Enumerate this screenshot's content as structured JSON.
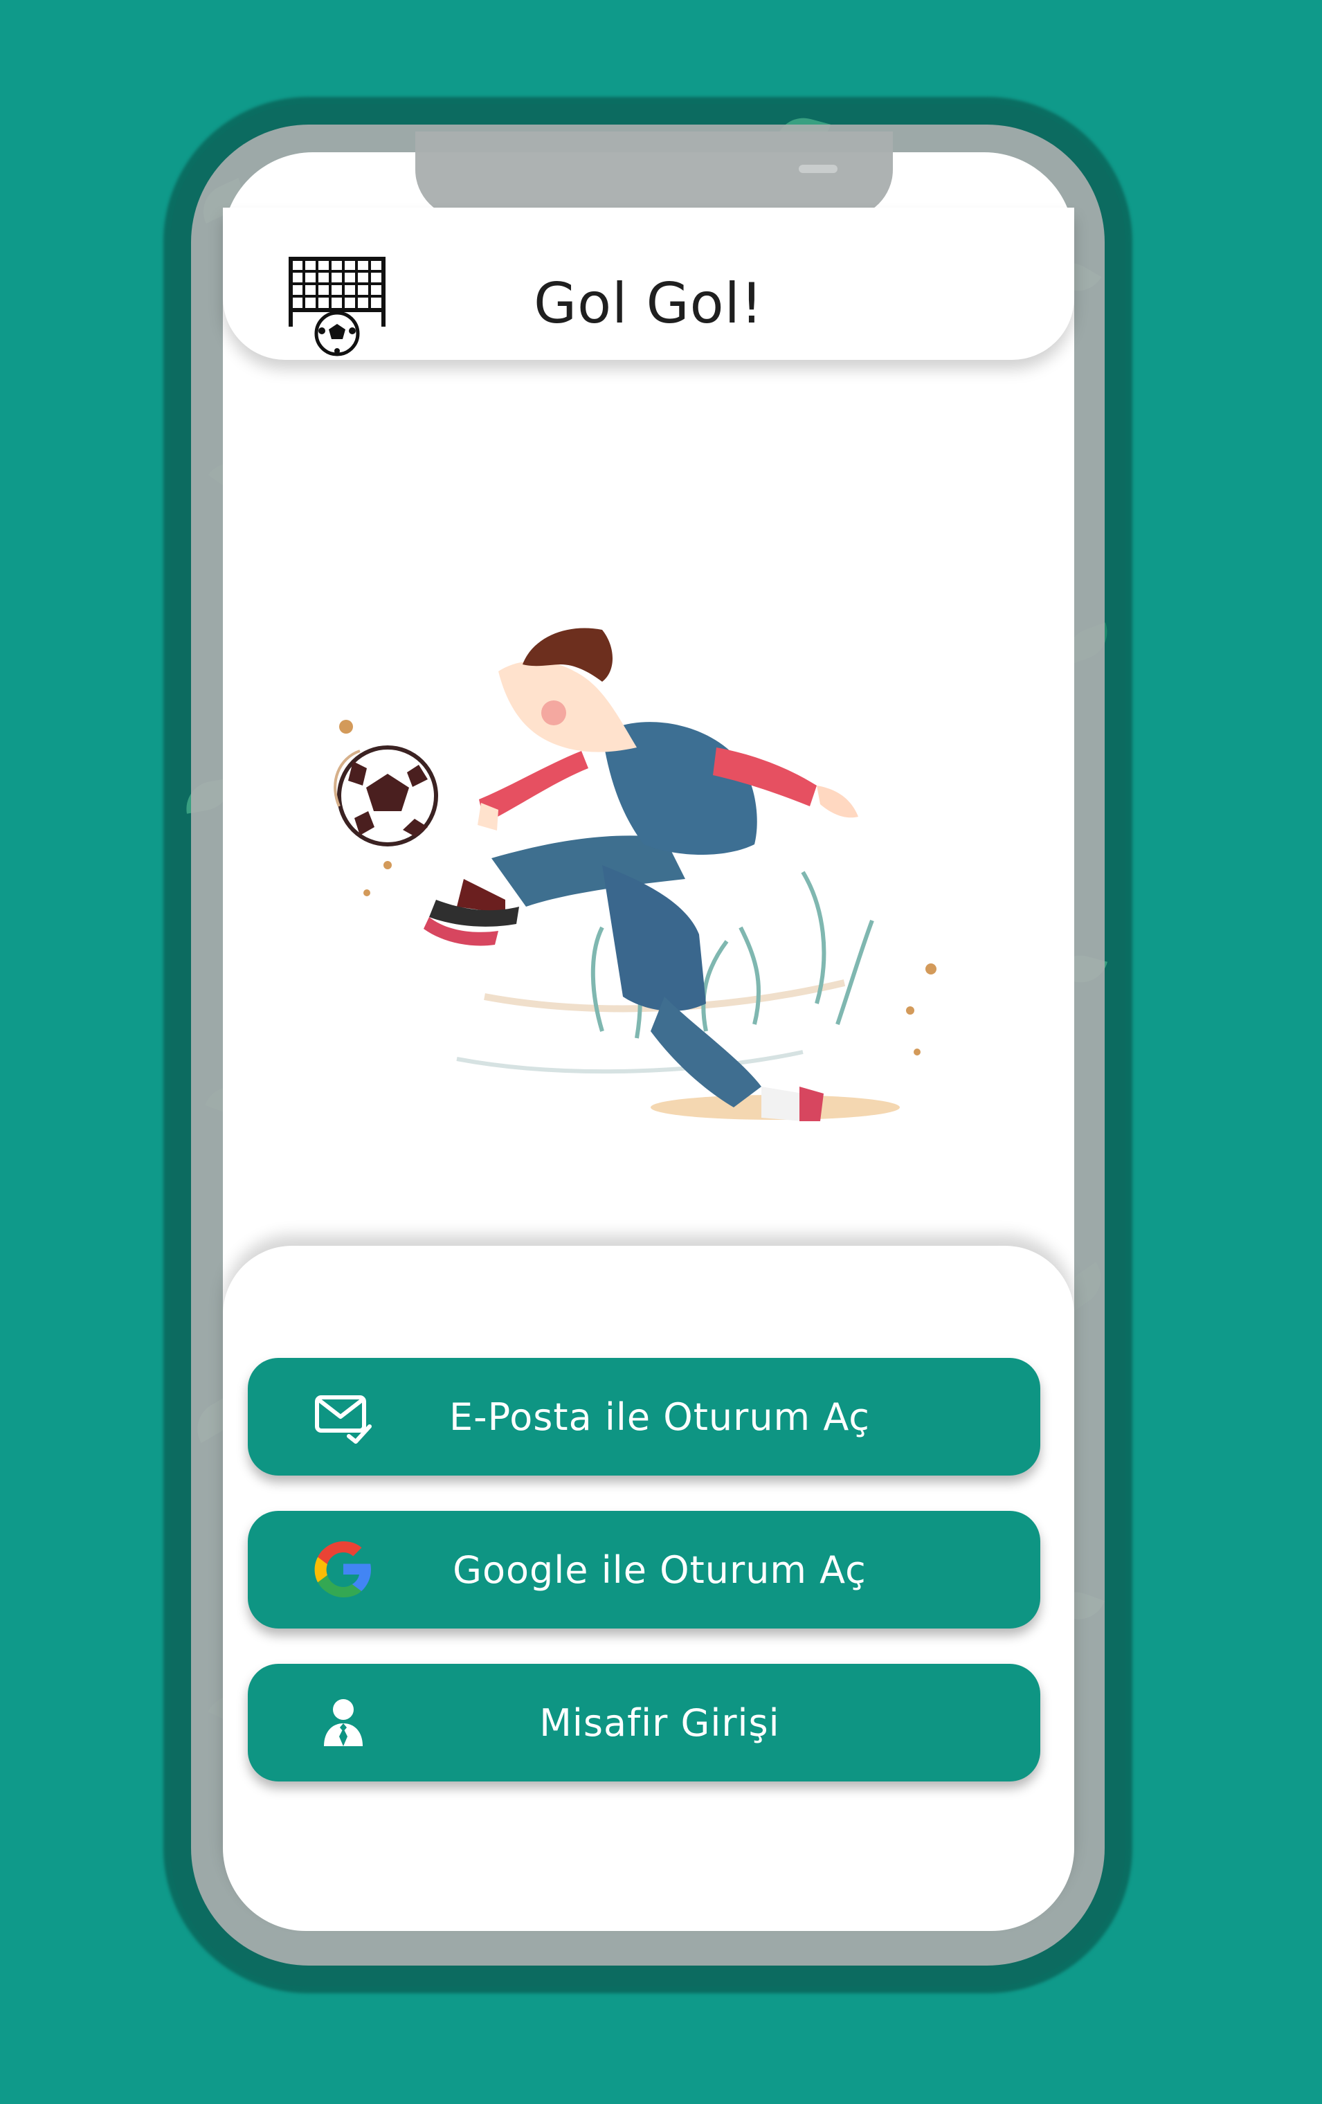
{
  "app": {
    "title": "Gol Gol!"
  },
  "buttons": {
    "email": {
      "label": "E-Posta ile Oturum Aç",
      "icon": "mail-check-icon"
    },
    "google": {
      "label": "Google ile Oturum Aç",
      "icon": "google-icon"
    },
    "guest": {
      "label": "Misafir Girişi",
      "icon": "user-icon"
    }
  },
  "illustration": {
    "subject": "football-player-kicking-ball-illustration"
  },
  "colors": {
    "background": "#0f9a8a",
    "primary": "#0e9583",
    "surface": "#ffffff",
    "text": "#1f1f1f"
  }
}
